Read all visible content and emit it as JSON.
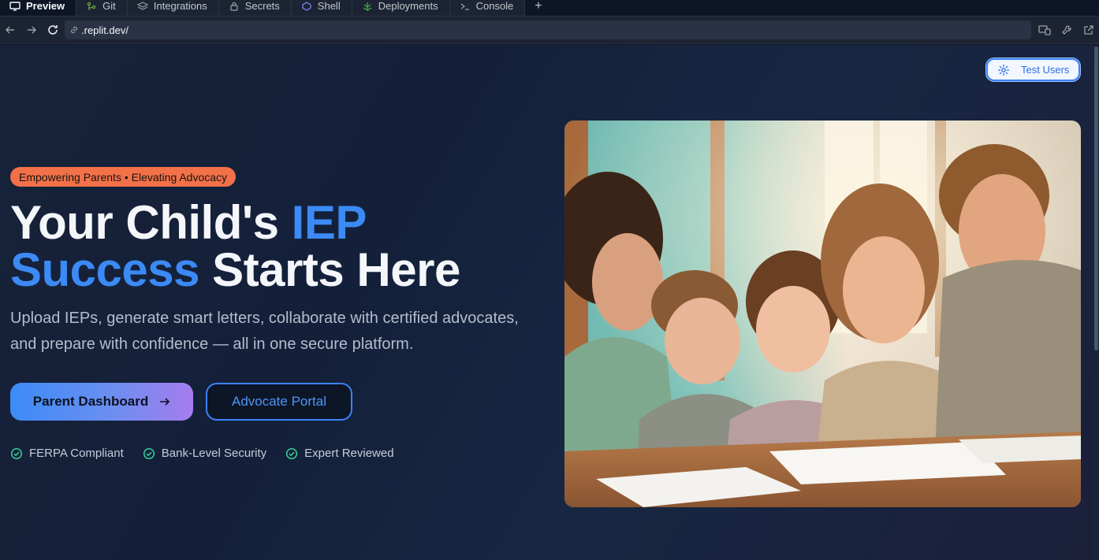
{
  "ide": {
    "tabs": [
      {
        "label": "Preview",
        "icon": "monitor-icon",
        "active": true
      },
      {
        "label": "Git",
        "icon": "git-icon"
      },
      {
        "label": "Integrations",
        "icon": "layers-icon"
      },
      {
        "label": "Secrets",
        "icon": "lock-icon"
      },
      {
        "label": "Shell",
        "icon": "shell-icon"
      },
      {
        "label": "Deployments",
        "icon": "deploy-icon"
      },
      {
        "label": "Console",
        "icon": "terminal-icon"
      }
    ],
    "add_tab": "+",
    "url": ".replit.dev/"
  },
  "page": {
    "test_users_label": "Test Users",
    "badge": "Empowering Parents • Elevating Advocacy",
    "headline": {
      "part1": "Your Child's ",
      "highlight": "IEP Success",
      "part2": " Starts Here"
    },
    "subtitle": "Upload IEPs, generate smart letters, collaborate with certified advocates, and prepare with confidence — all in one secure platform.",
    "primary_button": "Parent Dashboard",
    "secondary_button": "Advocate Portal",
    "trust_items": [
      "FERPA Compliant",
      "Bank-Level Security",
      "Expert Reviewed"
    ]
  },
  "colors": {
    "accent_blue": "#3b8af5",
    "badge_orange": "#f27149",
    "check_green": "#34d399"
  }
}
